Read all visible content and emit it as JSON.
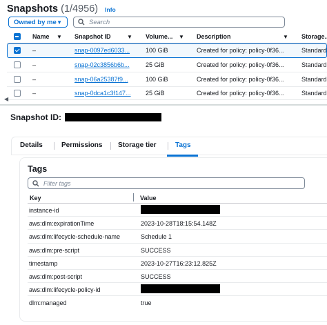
{
  "header": {
    "title": "Snapshots",
    "count": "(1/4956)",
    "info": "Info"
  },
  "filter": {
    "owner_label": "Owned by me",
    "search_placeholder": "Search"
  },
  "table": {
    "columns": [
      "Name",
      "Snapshot ID",
      "Volume...",
      "Description",
      "Storage..."
    ],
    "rows": [
      {
        "name": "–",
        "snapshot_id": "snap-0097ed6033...",
        "volume": "100 GiB",
        "description": "Created for policy: policy-0f36...",
        "storage": "Standard",
        "selected": true
      },
      {
        "name": "–",
        "snapshot_id": "snap-02c3856b6b...",
        "volume": "25 GiB",
        "description": "Created for policy: policy-0f36...",
        "storage": "Standard",
        "selected": false
      },
      {
        "name": "–",
        "snapshot_id": "snap-06a25387f9...",
        "volume": "100 GiB",
        "description": "Created for policy: policy-0f36...",
        "storage": "Standard",
        "selected": false
      },
      {
        "name": "–",
        "snapshot_id": "snap-0dca1c3f147...",
        "volume": "25 GiB",
        "description": "Created for policy: policy-0f36...",
        "storage": "Standard",
        "selected": false
      }
    ]
  },
  "details": {
    "label": "Snapshot ID:"
  },
  "tabs": [
    {
      "label": "Details",
      "active": false
    },
    {
      "label": "Permissions",
      "active": false
    },
    {
      "label": "Storage tier",
      "active": false
    },
    {
      "label": "Tags",
      "active": true
    }
  ],
  "tags_panel": {
    "title": "Tags",
    "filter_placeholder": "Filter tags",
    "columns": [
      "Key",
      "Value"
    ],
    "rows": [
      {
        "key": "instance-id",
        "value": "",
        "redacted": true
      },
      {
        "key": "aws:dlm:expirationTime",
        "value": "2023-10-28T18:15:54.148Z",
        "redacted": false
      },
      {
        "key": "aws:dlm:lifecycle-schedule-name",
        "value": "Schedule 1",
        "redacted": false
      },
      {
        "key": "aws:dlm:pre-script",
        "value": "SUCCESS",
        "redacted": false
      },
      {
        "key": "timestamp",
        "value": "2023-10-27T16:23:12.825Z",
        "redacted": false
      },
      {
        "key": "aws:dlm:post-script",
        "value": "SUCCESS",
        "redacted": false
      },
      {
        "key": "aws:dlm:lifecycle-policy-id",
        "value": "",
        "redacted": true
      },
      {
        "key": "dlm:managed",
        "value": "true",
        "redacted": false
      }
    ]
  },
  "icons": {
    "search": "search-icon",
    "caret": "caret-down-icon",
    "sort": "sort-caret-icon",
    "scroll": "scroll-left-icon"
  },
  "colors": {
    "accent": "#0972d3",
    "text": "#16191f",
    "border": "#7d8998"
  }
}
